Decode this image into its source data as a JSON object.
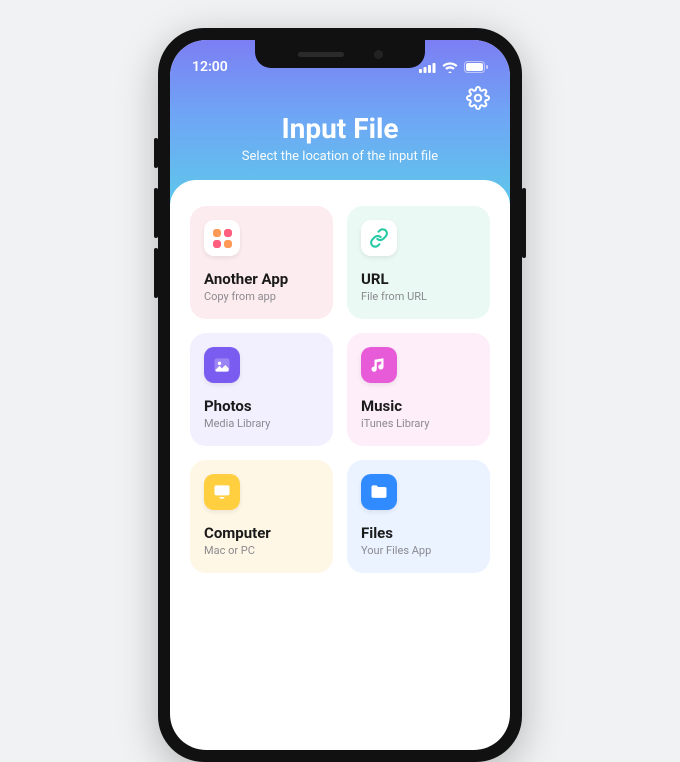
{
  "statusbar": {
    "time": "12:00"
  },
  "header": {
    "title": "Input File",
    "subtitle": "Select the location of the input file"
  },
  "cards": {
    "app": {
      "title": "Another App",
      "sub": "Copy from app"
    },
    "url": {
      "title": "URL",
      "sub": "File from URL"
    },
    "photo": {
      "title": "Photos",
      "sub": "Media Library"
    },
    "music": {
      "title": "Music",
      "sub": "iTunes Library"
    },
    "comp": {
      "title": "Computer",
      "sub": "Mac or PC"
    },
    "files": {
      "title": "Files",
      "sub": "Your Files App"
    }
  }
}
